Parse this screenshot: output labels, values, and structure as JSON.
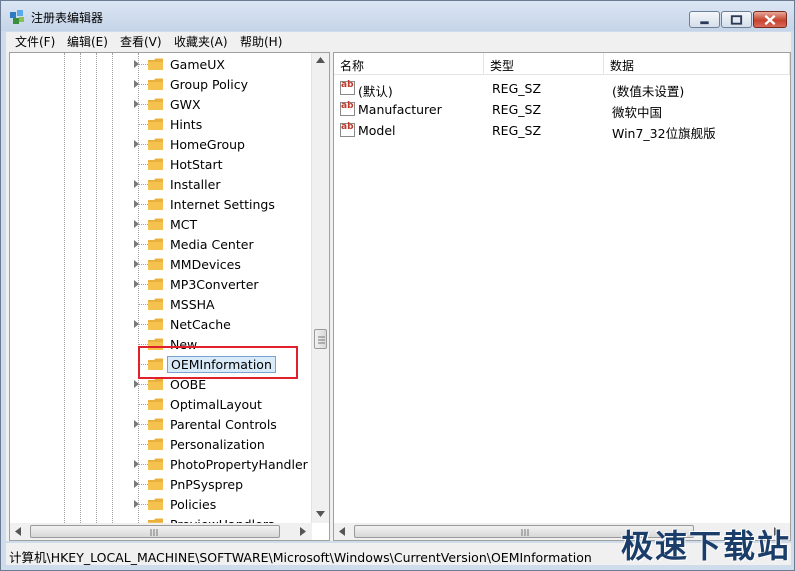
{
  "window": {
    "title": "注册表编辑器"
  },
  "menu": [
    "文件(F)",
    "编辑(E)",
    "查看(V)",
    "收藏夹(A)",
    "帮助(H)"
  ],
  "tree": {
    "items": [
      {
        "label": "GameUX",
        "expandable": true
      },
      {
        "label": "Group Policy",
        "expandable": true
      },
      {
        "label": "GWX",
        "expandable": true
      },
      {
        "label": "Hints",
        "expandable": false
      },
      {
        "label": "HomeGroup",
        "expandable": true
      },
      {
        "label": "HotStart",
        "expandable": false
      },
      {
        "label": "Installer",
        "expandable": true
      },
      {
        "label": "Internet Settings",
        "expandable": true
      },
      {
        "label": "MCT",
        "expandable": true
      },
      {
        "label": "Media Center",
        "expandable": true
      },
      {
        "label": "MMDevices",
        "expandable": true
      },
      {
        "label": "MP3Converter",
        "expandable": true
      },
      {
        "label": "MSSHA",
        "expandable": false
      },
      {
        "label": "NetCache",
        "expandable": true
      },
      {
        "label": "New",
        "expandable": false
      },
      {
        "label": "OEMInformation",
        "expandable": false,
        "selected": true
      },
      {
        "label": "OOBE",
        "expandable": true
      },
      {
        "label": "OptimalLayout",
        "expandable": false
      },
      {
        "label": "Parental Controls",
        "expandable": true
      },
      {
        "label": "Personalization",
        "expandable": false
      },
      {
        "label": "PhotoPropertyHandler",
        "expandable": true
      },
      {
        "label": "PnPSysprep",
        "expandable": true
      },
      {
        "label": "Policies",
        "expandable": true
      },
      {
        "label": "PreviewHandlers",
        "expandable": false
      }
    ]
  },
  "list": {
    "columns": [
      "名称",
      "类型",
      "数据"
    ],
    "rows": [
      {
        "name": "(默认)",
        "type": "REG_SZ",
        "data": "(数值未设置)"
      },
      {
        "name": "Manufacturer",
        "type": "REG_SZ",
        "data": "微软中国"
      },
      {
        "name": "Model",
        "type": "REG_SZ",
        "data": "Win7_32位旗舰版"
      }
    ]
  },
  "status": {
    "path": "计算机\\HKEY_LOCAL_MACHINE\\SOFTWARE\\Microsoft\\Windows\\CurrentVersion\\OEMInformation"
  },
  "watermark": "极速下载站",
  "colors": {
    "highlight": "#e0202a",
    "selection": "#d9eaf9",
    "folder": "#f4c24d"
  }
}
